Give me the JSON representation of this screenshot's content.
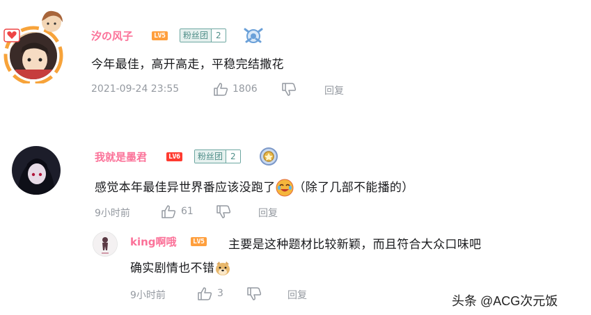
{
  "comments": [
    {
      "username": "汐の风子",
      "level": "LV5",
      "level_color": "#ff9f3d",
      "fan_group": "粉丝团",
      "fan_level": "2",
      "content": "今年最佳，高开高走，平稳完结撒花",
      "time": "2021-09-24 23:55",
      "likes": "1806",
      "reply_label": "回复"
    },
    {
      "username": "我就是墨君",
      "level": "LV6",
      "level_color": "#ff3b30",
      "fan_group": "粉丝团",
      "fan_level": "2",
      "content_before_emoji": "感觉本年最佳异世界番应该没跑了",
      "content_after_emoji": "（除了几部不能播的）",
      "time": "9小时前",
      "likes": "61",
      "reply_label": "回复",
      "replies": [
        {
          "username": "king啊哦",
          "level": "LV5",
          "level_color": "#ff9f3d",
          "content_line1": "主要是这种题材比较新颖，而且符合大众口味吧",
          "content_line2": "确实剧情也不错",
          "time": "9小时前",
          "likes": "3",
          "reply_label": "回复"
        }
      ]
    }
  ],
  "watermark": "头条 @ACG次元饭",
  "colors": {
    "username": "#fb7299",
    "meta": "#9499a0",
    "fan_badge_border": "#6ba6a0"
  }
}
